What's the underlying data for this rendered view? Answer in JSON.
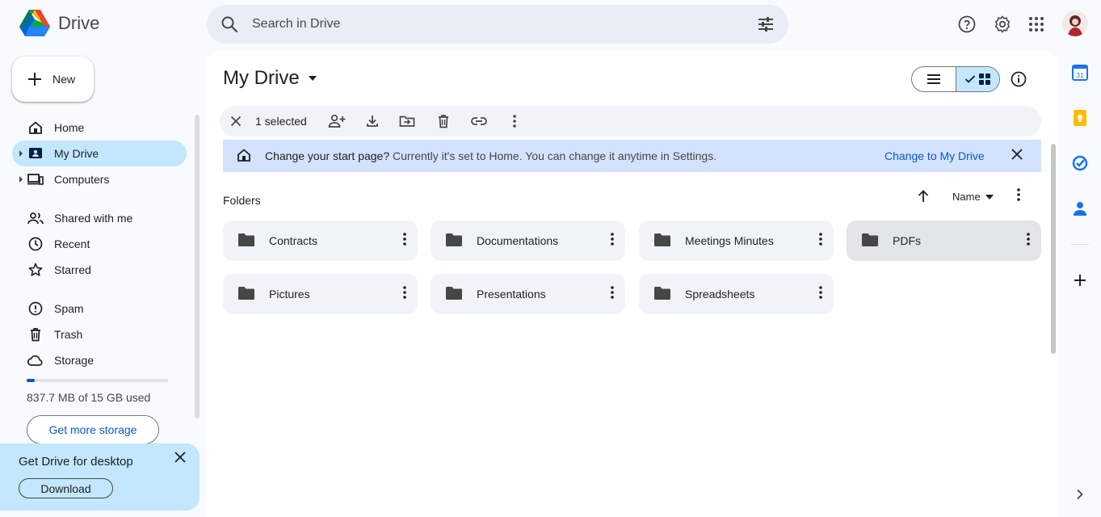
{
  "app": {
    "name": "Drive",
    "search_placeholder": "Search in Drive"
  },
  "left_nav": {
    "new_label": "New",
    "items": [
      {
        "label": "Home",
        "icon": "home-icon"
      },
      {
        "label": "My Drive",
        "icon": "my-drive-icon",
        "active": true
      },
      {
        "label": "Computers",
        "icon": "computers-icon"
      },
      {
        "label": "Shared with me",
        "icon": "shared-icon"
      },
      {
        "label": "Recent",
        "icon": "recent-icon"
      },
      {
        "label": "Starred",
        "icon": "star-icon"
      },
      {
        "label": "Spam",
        "icon": "spam-icon"
      },
      {
        "label": "Trash",
        "icon": "trash-icon"
      },
      {
        "label": "Storage",
        "icon": "cloud-icon"
      }
    ],
    "storage_text": "837.7 MB of 15 GB used",
    "storage_fraction": 0.056,
    "get_storage_label": "Get more storage"
  },
  "promo": {
    "title": "Get Drive for desktop",
    "download_label": "Download"
  },
  "main": {
    "title": "My Drive",
    "selection": {
      "count_text": "1 selected"
    },
    "banner": {
      "question": "Change your start page?",
      "text": " Currently it's set to Home. You can change it anytime in Settings.",
      "action": "Change to My Drive"
    },
    "folders_label": "Folders",
    "sort_label": "Name",
    "folders": [
      {
        "name": "Contracts",
        "selected": false
      },
      {
        "name": "Documentations",
        "selected": false
      },
      {
        "name": "Meetings Minutes",
        "selected": false
      },
      {
        "name": "PDFs",
        "selected": true
      },
      {
        "name": "Pictures",
        "selected": false
      },
      {
        "name": "Presentations",
        "selected": false
      },
      {
        "name": "Spreadsheets",
        "selected": false
      }
    ]
  },
  "colors": {
    "accent": "#0b57d0",
    "active_bg": "#c2e7ff",
    "banner_bg": "#d3e3fd"
  }
}
